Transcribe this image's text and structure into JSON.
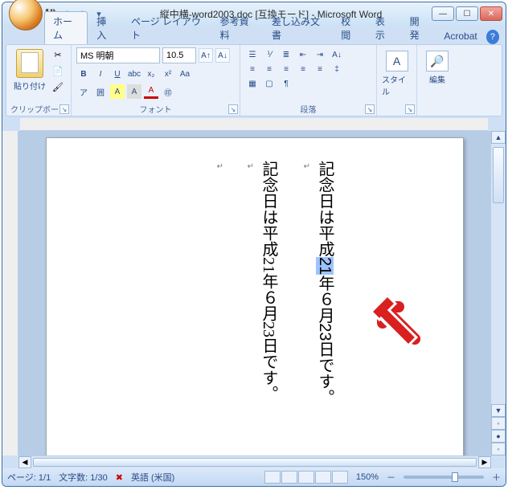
{
  "title": "縦中横-word2003.doc [互換モード] - Microsoft Word",
  "tabs": {
    "home": "ホーム",
    "insert": "挿入",
    "layout": "ページ レイアウト",
    "ref": "参考資料",
    "mail": "差し込み文書",
    "review": "校閲",
    "view": "表示",
    "dev": "開発",
    "acrobat": "Acrobat"
  },
  "clipboard": {
    "paste": "貼り付け",
    "label": "クリップボード"
  },
  "font": {
    "name": "MS 明朝",
    "size": "10.5",
    "label": "フォント"
  },
  "paragraph": {
    "label": "段落"
  },
  "styles": {
    "label": "スタイル"
  },
  "edit": {
    "label": "編集"
  },
  "doc": {
    "line1_a": "記念日は平成",
    "line1_hl": "21",
    "line1_b": "年６月23日です。",
    "line2": "記念日は平成21年６月23日です。"
  },
  "status": {
    "page": "ページ: 1/1",
    "words": "文字数: 1/30",
    "lang": "英語 (米国)",
    "zoom": "150%"
  },
  "icons": {
    "save": "💾",
    "undo": "↶",
    "redo": "↷",
    "cut": "✂",
    "copy": "📄",
    "brush": "🖌",
    "bold": "B",
    "italic": "I",
    "underline": "U",
    "A_bg": "A",
    "ruby": "ア",
    "styleA": "A",
    "find": "🔎",
    "min": "—",
    "max": "☐",
    "close": "✕",
    "help": "?",
    "dropdown": "▾",
    "up": "▲",
    "down": "▼",
    "left": "◀",
    "right": "▶",
    "plus": "＋",
    "minus": "－"
  }
}
